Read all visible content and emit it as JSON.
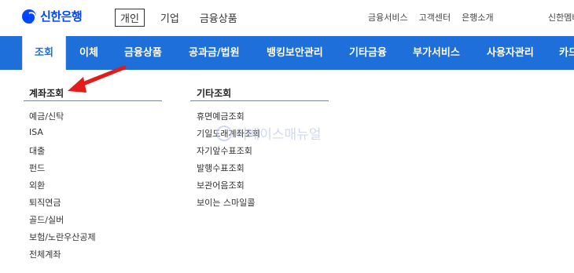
{
  "header": {
    "brand": "신한은행",
    "segments": [
      "개인",
      "기업",
      "금융상품"
    ],
    "links": [
      "금융서비스",
      "고객센터",
      "은행소개"
    ],
    "right_text": "신한멤버"
  },
  "nav": {
    "items": [
      "조회",
      "이체",
      "금융상품",
      "공과금/법원",
      "뱅킹보안관리",
      "기타금융",
      "부가서비스",
      "사용자관리",
      "카드"
    ]
  },
  "dropdown": {
    "account": {
      "title": "계좌조회",
      "items": [
        "예금/신탁",
        "ISA",
        "대출",
        "펀드",
        "외환",
        "퇴직연금",
        "골드/실버",
        "보험/노란우산공제",
        "전체계좌"
      ]
    },
    "other": {
      "title": "기타조회",
      "items": [
        "휴면예금조회",
        "기일도래계좌조회",
        "자기앞수표조회",
        "발행수표조회",
        "보관어음조회",
        "보이는 스마일콜"
      ]
    }
  },
  "watermark": "이베이스매뉴얼",
  "colors": {
    "brand": "#0046ff",
    "nav_bg": "#1e6fd9",
    "arrow": "#e21b1b"
  }
}
